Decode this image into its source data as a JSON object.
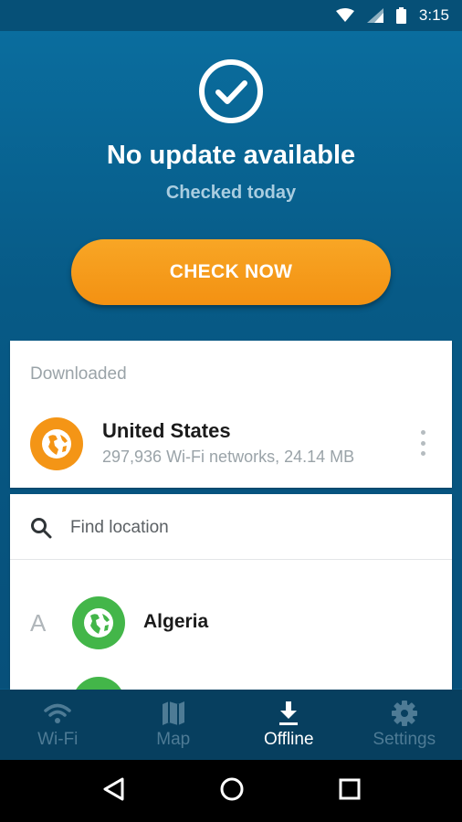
{
  "status_bar": {
    "time": "3:15",
    "icons": [
      "wifi-icon",
      "signal-icon",
      "battery-icon"
    ]
  },
  "hero": {
    "icon": "check-circle-icon",
    "title": "No update available",
    "subtitle": "Checked today",
    "button_label": "CHECK NOW"
  },
  "downloaded": {
    "section_label": "Downloaded",
    "items": [
      {
        "name": "United States",
        "meta": "297,936 Wi-Fi networks, 24.14 MB",
        "icon": "globe-icon",
        "color": "#f49516"
      }
    ]
  },
  "locations": {
    "search_placeholder": "Find location",
    "groups": [
      {
        "letter": "A",
        "items": [
          {
            "name": "Algeria",
            "icon": "globe-icon",
            "color": "#43b649"
          }
        ]
      }
    ]
  },
  "tabs": [
    {
      "label": "Wi-Fi",
      "icon": "wifi-icon",
      "active": false
    },
    {
      "label": "Map",
      "icon": "map-icon",
      "active": false
    },
    {
      "label": "Offline",
      "icon": "download-icon",
      "active": true
    },
    {
      "label": "Settings",
      "icon": "gear-icon",
      "active": false
    }
  ],
  "colors": {
    "accent": "#f39112",
    "header": "#0a5a86",
    "tabbar": "#073f5f",
    "inactive_tab": "#4e7b95"
  }
}
